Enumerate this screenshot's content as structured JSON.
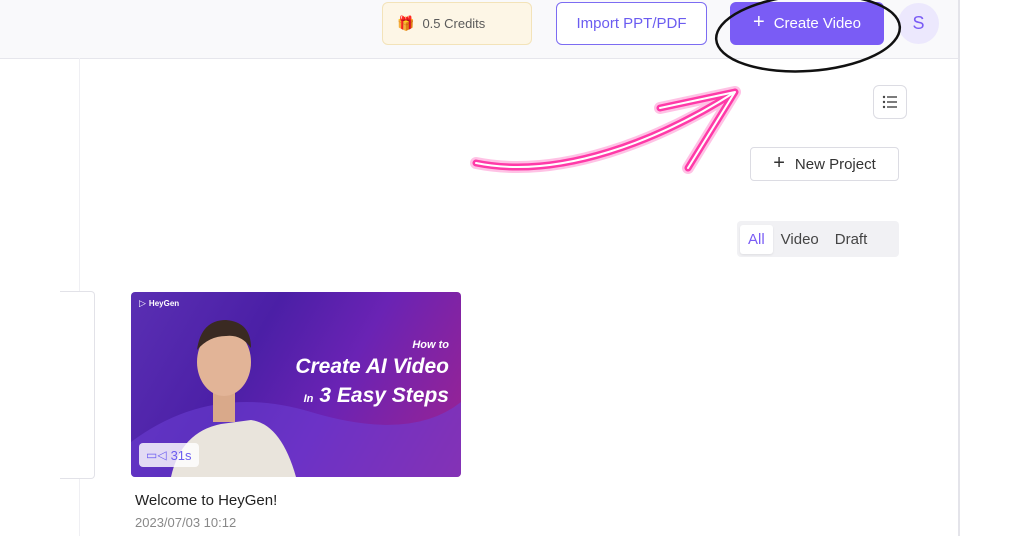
{
  "header": {
    "credits_icon": "gift-icon",
    "credits_text": "0.5 Credits",
    "import_label": "Import PPT/PDF",
    "create_label": "Create Video",
    "avatar_initial": "S"
  },
  "toolbar": {
    "new_project_label": "New Project",
    "filters": [
      "All",
      "Video",
      "Draft"
    ],
    "active_filter": "All"
  },
  "video_card": {
    "thumb_brand": "HeyGen",
    "thumb_line1": "How to",
    "thumb_line2": "Create AI Video",
    "thumb_line3_prefix": "In",
    "thumb_line3": "3 Easy Steps",
    "duration": "31s",
    "title": "Welcome to HeyGen!",
    "date": "2023/07/03 10:12"
  },
  "colors": {
    "accent": "#7a5cf5",
    "annotation_arrow": "#ff3aa8",
    "annotation_circle": "#111111"
  }
}
